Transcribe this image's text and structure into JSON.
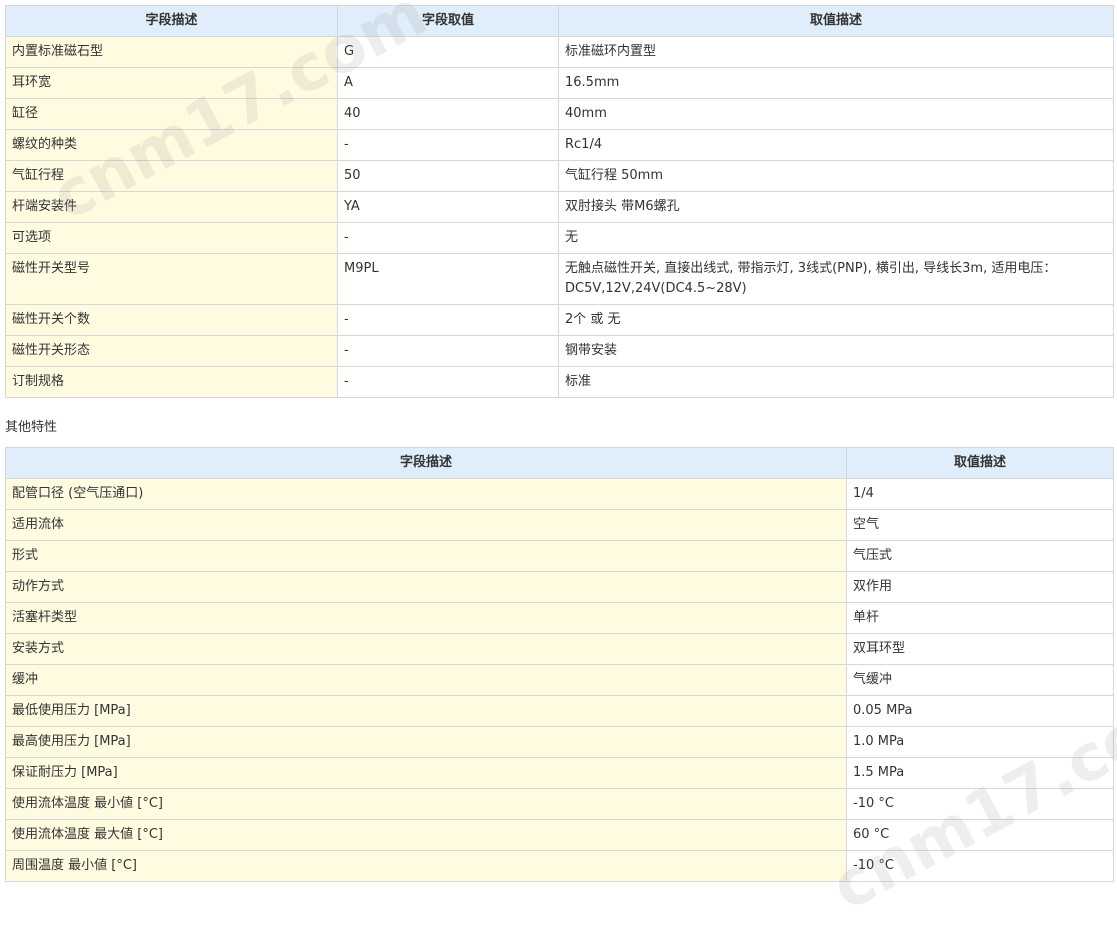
{
  "spec_table": {
    "headers": [
      "字段描述",
      "字段取值",
      "取值描述"
    ],
    "rows": [
      {
        "field": "内置标准磁石型",
        "value": "G",
        "desc": "标准磁环内置型"
      },
      {
        "field": "耳环宽",
        "value": "A",
        "desc": "16.5mm"
      },
      {
        "field": "缸径",
        "value": "40",
        "desc": "40mm"
      },
      {
        "field": "螺纹的种类",
        "value": "-",
        "desc": "Rc1/4"
      },
      {
        "field": "气缸行程",
        "value": "50",
        "desc": "气缸行程 50mm"
      },
      {
        "field": "杆端安装件",
        "value": "YA",
        "desc": "双肘接头 带M6螺孔"
      },
      {
        "field": "可选项",
        "value": "-",
        "desc": "无"
      },
      {
        "field": "磁性开关型号",
        "value": "M9PL",
        "desc": "无触点磁性开关, 直接出线式, 带指示灯, 3线式(PNP), 横引出, 导线长3m, 适用电压：DC5V,12V,24V(DC4.5~28V)"
      },
      {
        "field": "磁性开关个数",
        "value": "-",
        "desc": "2个 或 无"
      },
      {
        "field": "磁性开关形态",
        "value": "-",
        "desc": "钢带安装"
      },
      {
        "field": "订制规格",
        "value": "-",
        "desc": "标准"
      }
    ]
  },
  "other_section_title": "其他特性",
  "other_table": {
    "headers": [
      "字段描述",
      "取值描述"
    ],
    "rows": [
      {
        "field": "配管口径 (空气压通口)",
        "desc": "1/4"
      },
      {
        "field": "适用流体",
        "desc": "空气"
      },
      {
        "field": "形式",
        "desc": "气压式"
      },
      {
        "field": "动作方式",
        "desc": "双作用"
      },
      {
        "field": "活塞杆类型",
        "desc": "单杆"
      },
      {
        "field": "安装方式",
        "desc": "双耳环型"
      },
      {
        "field": "缓冲",
        "desc": "气缓冲"
      },
      {
        "field": "最低使用压力 [MPa]",
        "desc": "0.05 MPa"
      },
      {
        "field": "最高使用压力 [MPa]",
        "desc": "1.0 MPa"
      },
      {
        "field": "保证耐压力 [MPa]",
        "desc": "1.5 MPa"
      },
      {
        "field": "使用流体温度 最小値 [°C]",
        "desc": "-10 °C"
      },
      {
        "field": "使用流体温度 最大値 [°C]",
        "desc": "60 °C"
      },
      {
        "field": "周围温度 最小値 [°C]",
        "desc": "-10 °C"
      }
    ]
  },
  "watermark": "cnm17.com",
  "colors": {
    "header_bg": "#dfeefa",
    "label_bg": "#fffbe1",
    "border": "#d7d7d7",
    "text": "#333333"
  }
}
